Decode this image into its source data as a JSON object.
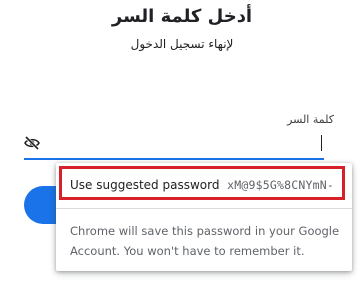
{
  "page": {
    "title": "أدخل كلمة السر",
    "subtitle": "لإنهاء تسجيل الدخول"
  },
  "password_field": {
    "label": "كلمة السر",
    "value": "",
    "visibility_icon": "eye-off-icon"
  },
  "suggestion_popup": {
    "suggest_label": "Use suggested password",
    "suggested_password": "xM@9$5G%8CNYmN-",
    "info_text": "Chrome will save this password in your Google Account. You won't have to remember it."
  },
  "colors": {
    "accent": "#1a73e8",
    "highlight_border": "#d6212b"
  }
}
